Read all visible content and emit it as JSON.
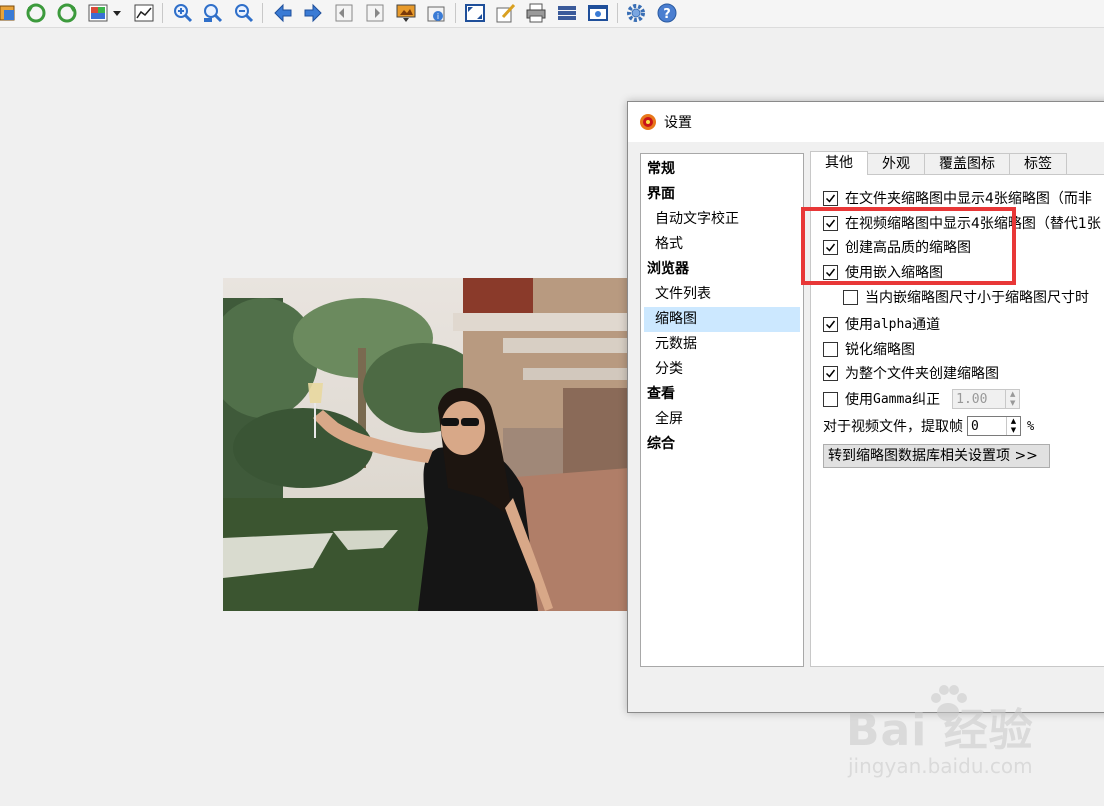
{
  "dialog": {
    "title": "设置",
    "nav": [
      {
        "label": "常规",
        "level": "category",
        "selected": false
      },
      {
        "label": "界面",
        "level": "category",
        "selected": false
      },
      {
        "label": "自动文字校正",
        "level": "child",
        "selected": false
      },
      {
        "label": "格式",
        "level": "child",
        "selected": false
      },
      {
        "label": "浏览器",
        "level": "category",
        "selected": false
      },
      {
        "label": "文件列表",
        "level": "child",
        "selected": false
      },
      {
        "label": "缩略图",
        "level": "child",
        "selected": true
      },
      {
        "label": "元数据",
        "level": "child",
        "selected": false
      },
      {
        "label": "分类",
        "level": "child",
        "selected": false
      },
      {
        "label": "查看",
        "level": "category",
        "selected": false
      },
      {
        "label": "全屏",
        "level": "child",
        "selected": false
      },
      {
        "label": "综合",
        "level": "category",
        "selected": false
      }
    ],
    "tabs": [
      "其他",
      "外观",
      "覆盖图标",
      "标签"
    ],
    "active_tab": "其他",
    "options": [
      {
        "label": "在文件夹缩略图中显示4张缩略图（而非",
        "checked": true
      },
      {
        "label": "在视频缩略图中显示4张缩略图（替代1张",
        "checked": true
      },
      {
        "label": "创建高品质的缩略图",
        "checked": true
      },
      {
        "label": "使用嵌入缩略图",
        "checked": true
      },
      {
        "label": "当内嵌缩略图尺寸小于缩略图尺寸时",
        "checked": false
      },
      {
        "label_prefix": "使用",
        "label_mono": "alpha",
        "label_suffix": "通道",
        "checked": true
      },
      {
        "label": "锐化缩略图",
        "checked": false
      },
      {
        "label": "为整个文件夹创建缩略图",
        "checked": true
      },
      {
        "label_prefix": "使用",
        "label_mono": "Gamma",
        "label_suffix": "纠正",
        "checked": false,
        "spin_value": "1.00"
      }
    ],
    "video_frame": {
      "label": "对于视频文件，提取帧",
      "value": "0",
      "unit": "%"
    },
    "goto_button": "转到缩略图数据库相关设置项 >>"
  },
  "colors": {
    "highlight": "#e83737",
    "selection": "#cce8ff",
    "toolbar_blue": "#2f6fc9"
  },
  "toolbar": {
    "icons": [
      "select-icon",
      "rotate-left-icon",
      "rotate-right-icon",
      "color-icon",
      "dropdown-icon",
      "histogram-icon",
      "zoom-in-icon",
      "zoom-fit-icon",
      "zoom-out-icon",
      "previous-icon",
      "next-icon",
      "first-icon",
      "last-icon",
      "slideshow-icon",
      "info-icon",
      "fullscreen-icon",
      "edit-icon",
      "print-icon",
      "scanner-icon",
      "capture-icon",
      "settings-icon",
      "help-icon"
    ]
  },
  "watermark": {
    "main": "Bai  经验",
    "sub": "jingyan.baidu.com"
  }
}
